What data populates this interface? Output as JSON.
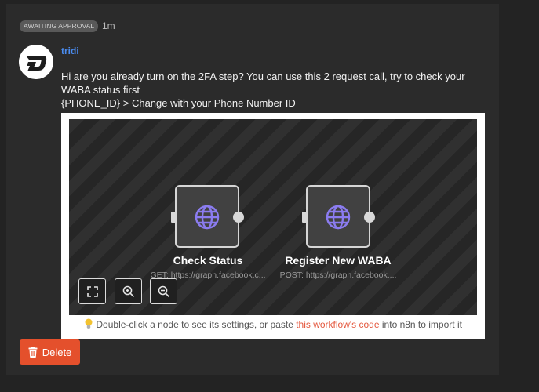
{
  "post": {
    "badge": "AWAITING APPROVAL",
    "age": "1m",
    "author": "tridi",
    "message_line1": "Hi are you already turn on the 2FA step? You can use this 2 request call, try to check your WABA status first",
    "message_line2": "{PHONE_ID} > Change with your Phone Number ID"
  },
  "workflow": {
    "nodes": [
      {
        "title": "Check Status",
        "subtitle": "GET: https://graph.facebook.c...",
        "icon": "globe-icon"
      },
      {
        "title": "Register New WABA",
        "subtitle": "POST: https://graph.facebook....",
        "icon": "globe-icon"
      }
    ],
    "controls": [
      {
        "icon": "fit-view-icon"
      },
      {
        "icon": "zoom-in-icon"
      },
      {
        "icon": "zoom-out-icon"
      }
    ],
    "hint_prefix": "Double-click a node to see its settings, or paste",
    "hint_link": "this workflow's code",
    "hint_suffix": "into n8n to import it"
  },
  "actions": {
    "delete_label": "Delete"
  },
  "colors": {
    "accent": "#e4502c",
    "author": "#4a8cf0",
    "node_icon": "#8b7cf0"
  }
}
